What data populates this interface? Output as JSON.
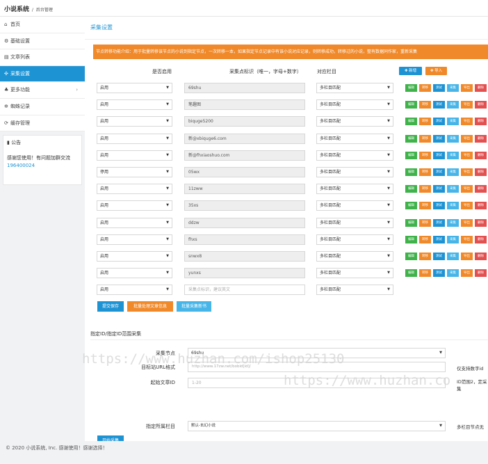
{
  "app": {
    "name": "小说系统",
    "section": "后台管理"
  },
  "sidebar": {
    "items": [
      {
        "icon": "home-icon",
        "glyph": "⌂",
        "label": "首页"
      },
      {
        "icon": "gear-icon",
        "glyph": "⚙",
        "label": "基础设置"
      },
      {
        "icon": "list-icon",
        "glyph": "▤",
        "label": "文章列表"
      },
      {
        "icon": "share-icon",
        "glyph": "✣",
        "label": "采集设置"
      },
      {
        "icon": "sitemap-icon",
        "glyph": "♣",
        "label": "更多功能"
      },
      {
        "icon": "spider-icon",
        "glyph": "✲",
        "label": "蜘蛛记录"
      },
      {
        "icon": "refresh-icon",
        "glyph": "⟳",
        "label": "缓存管理"
      }
    ],
    "notice": {
      "title": "公告",
      "body": "感谢您使用！有问题加群交流",
      "link": "196400024"
    }
  },
  "main": {
    "title": "采集设置",
    "alert": "节点转移功能介绍：用于批量转移该节点的小说到指定节点，一次转移一本，如果指定节点记录中有该小说对应记录，则转移成功，转移过的小说，整有数据同作家，重新采集",
    "headers": {
      "enabled": "是否启用",
      "node_id": "采集点标识（唯一，字母+数字）",
      "column": "对应栏目"
    },
    "add_button": "✚ 新增",
    "import_button": "✚ 导入",
    "rows": [
      {
        "enabled": "启用",
        "node": "69shu",
        "column": "多栏目匹配"
      },
      {
        "enabled": "启用",
        "node": "笔趣图",
        "column": "多栏目匹配"
      },
      {
        "enabled": "启用",
        "node": "biquge5200",
        "column": "多栏目匹配"
      },
      {
        "enabled": "启用",
        "node": "新@xbiquge6.com",
        "column": "多栏目匹配"
      },
      {
        "enabled": "启用",
        "node": "新@fhxiaoshuo.com",
        "column": "多栏目匹配"
      },
      {
        "enabled": "停用",
        "node": "05wx",
        "column": "多栏目匹配"
      },
      {
        "enabled": "启用",
        "node": "11zww",
        "column": "多栏目匹配"
      },
      {
        "enabled": "启用",
        "node": "35xs",
        "column": "多栏目匹配"
      },
      {
        "enabled": "启用",
        "node": "ddzw",
        "column": "多栏目匹配"
      },
      {
        "enabled": "启用",
        "node": "fhxs",
        "column": "多栏目匹配"
      },
      {
        "enabled": "启用",
        "node": "snwx8",
        "column": "多栏目匹配"
      },
      {
        "enabled": "启用",
        "node": "yunxs",
        "column": "多栏目匹配"
      }
    ],
    "new_row": {
      "enabled": "启用",
      "placeholder": "采集点标识，建议英文",
      "column": "多栏目匹配"
    },
    "row_actions": [
      "编辑",
      "转移",
      "测试",
      "采集",
      "导出",
      "删除"
    ],
    "submit_button": "提交保存",
    "batch_button": "批量处理文章信息",
    "batch_collect_button": "批量采集新书",
    "range_section": {
      "title": "指定ID/指定ID范围采集",
      "node_label": "采集节点",
      "node_value": "69shu",
      "url_label": "目标站URL格式",
      "url_placeholder": "http://www.17zw.net/bobid[id]/",
      "url_help": "仅支持数字id",
      "start_label": "起始文章ID",
      "start_placeholder": "1-20",
      "start_help": "ID范围2，定采集",
      "column_label": "指定所属栏目",
      "column_value": "默认-玄幻小说",
      "column_help": "多栏目节点无",
      "start_button": "开始采集"
    },
    "footer": "© 2020 小说系统, Inc. 感谢使用！感谢选择！"
  },
  "watermarks": [
    "https://www.huzhan.com/ishop25130",
    "https://www.huzhan.co"
  ],
  "colors": {
    "primary": "#1e93d4",
    "orange": "#f0892a",
    "green": "#3fb24a",
    "red": "#e25050",
    "cyan": "#47b5e8"
  }
}
